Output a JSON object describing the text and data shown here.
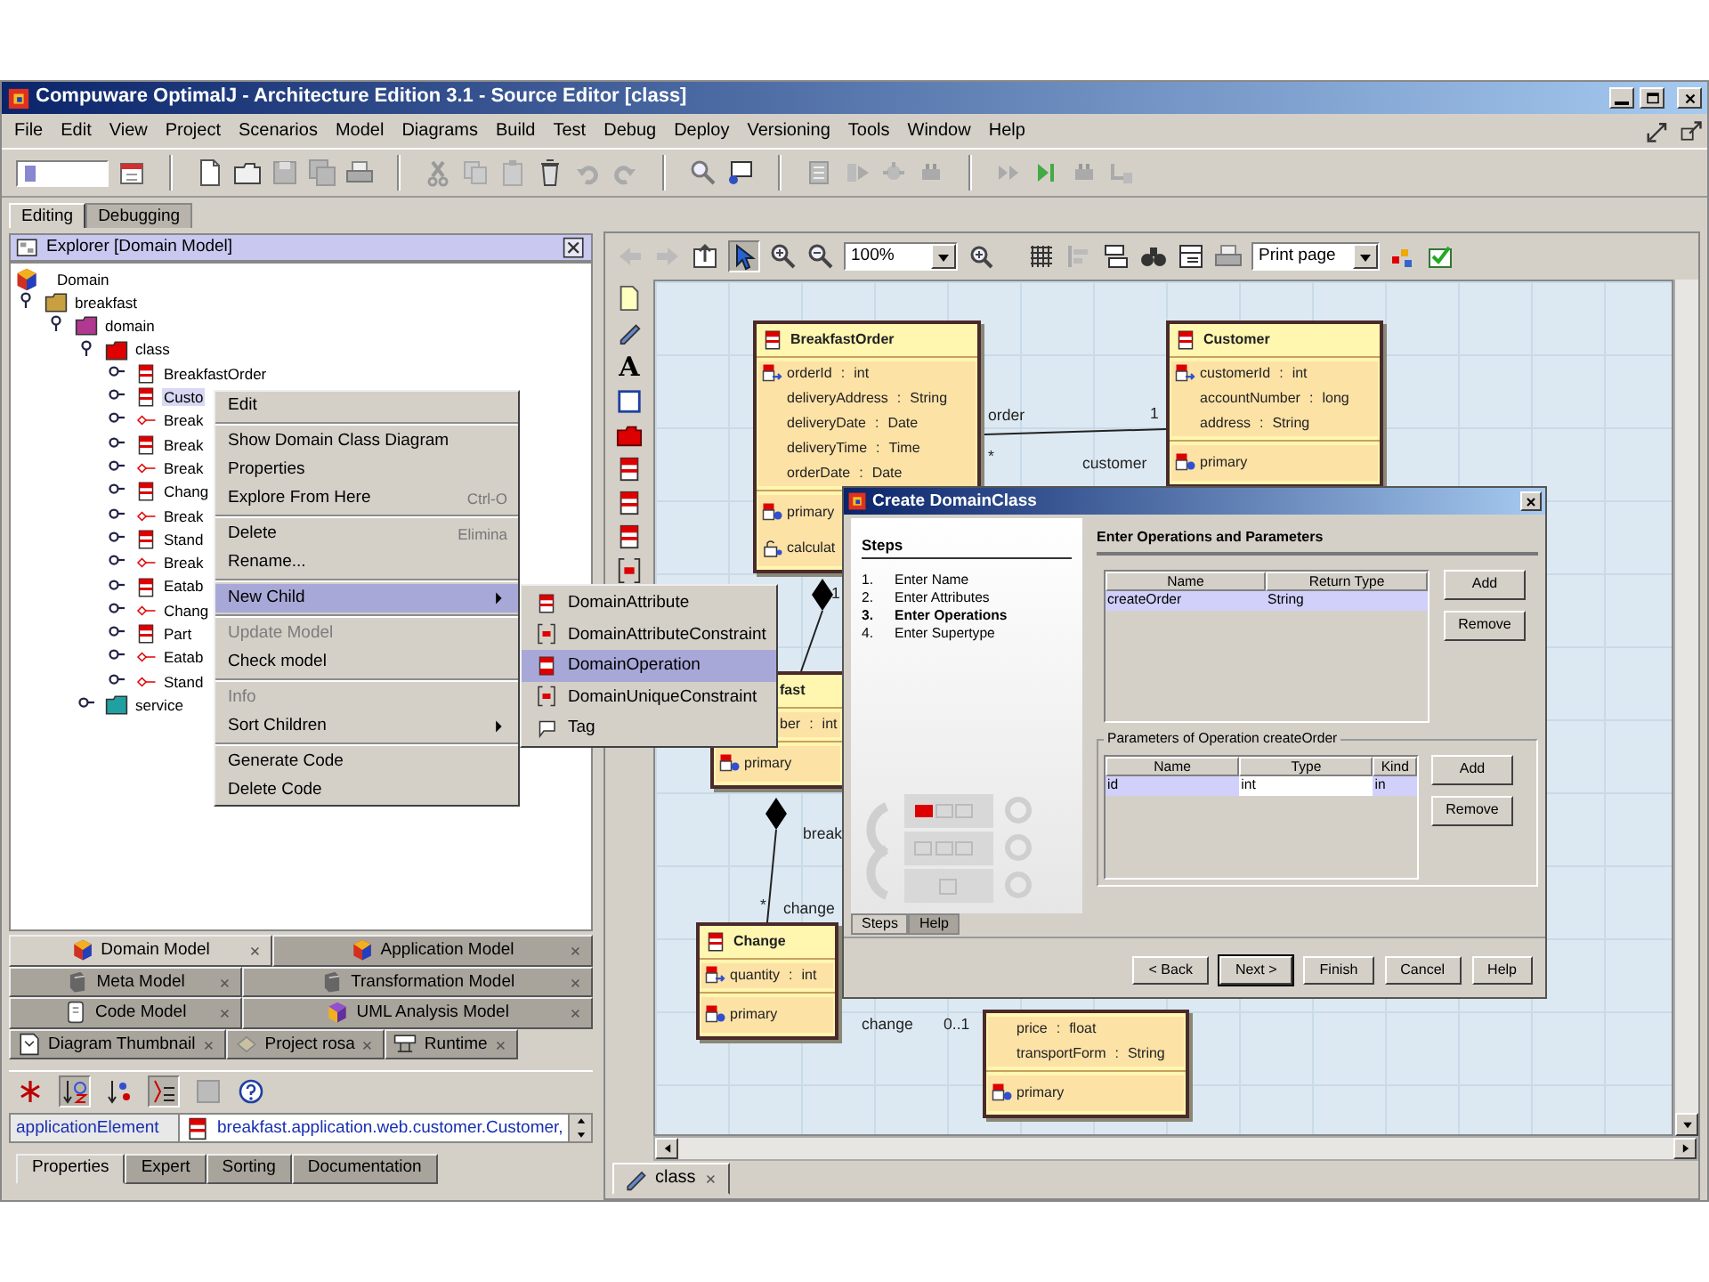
{
  "window": {
    "title": "Compuware OptimalJ - Architecture Edition 3.1  - Source Editor [class]"
  },
  "menu_bar": [
    "File",
    "Edit",
    "View",
    "Project",
    "Scenarios",
    "Model",
    "Diagrams",
    "Build",
    "Test",
    "Debug",
    "Deploy",
    "Versioning",
    "Tools",
    "Window",
    "Help"
  ],
  "perspective_tabs": [
    {
      "label": "Editing",
      "selected": true
    },
    {
      "label": "Debugging",
      "selected": false
    }
  ],
  "explorer": {
    "title": "Explorer [Domain Model]",
    "tree": [
      {
        "label": "Domain",
        "kind": "model",
        "selected": false,
        "children": [
          {
            "label": "breakfast",
            "kind": "package",
            "color": "#c8a040",
            "expanded": true,
            "selected": false,
            "children": [
              {
                "label": "domain",
                "kind": "package",
                "color": "#b03890",
                "expanded": true,
                "selected": false,
                "children": [
                  {
                    "label": "class",
                    "kind": "package",
                    "color": "#e00000",
                    "expanded": true,
                    "selected": false,
                    "children": [
                      {
                        "label": "BreakfastOrder",
                        "kind": "class",
                        "expanded": false,
                        "selected": false
                      },
                      {
                        "label": "Custo",
                        "kind": "class",
                        "expanded": false,
                        "selected": true
                      },
                      {
                        "label": "Break",
                        "kind": "association",
                        "expanded": false,
                        "selected": false
                      },
                      {
                        "label": "Break",
                        "kind": "class",
                        "expanded": false,
                        "selected": false
                      },
                      {
                        "label": "Break",
                        "kind": "association",
                        "expanded": false,
                        "selected": false
                      },
                      {
                        "label": "Chang",
                        "kind": "class",
                        "expanded": false,
                        "selected": false
                      },
                      {
                        "label": "Break",
                        "kind": "association",
                        "expanded": false,
                        "selected": false
                      },
                      {
                        "label": "Stand",
                        "kind": "class",
                        "expanded": false,
                        "selected": false
                      },
                      {
                        "label": "Break",
                        "kind": "association",
                        "expanded": false,
                        "selected": false
                      },
                      {
                        "label": "Eatab",
                        "kind": "class",
                        "expanded": false,
                        "selected": false
                      },
                      {
                        "label": "Chang",
                        "kind": "association",
                        "expanded": false,
                        "selected": false
                      },
                      {
                        "label": "Part",
                        "kind": "class",
                        "expanded": false,
                        "selected": false
                      },
                      {
                        "label": "Eatab",
                        "kind": "association",
                        "expanded": false,
                        "selected": false
                      },
                      {
                        "label": "Stand",
                        "kind": "association",
                        "expanded": false,
                        "selected": false
                      }
                    ]
                  },
                  {
                    "label": "service",
                    "kind": "package",
                    "color": "#20a0a0",
                    "expanded": false,
                    "selected": false
                  }
                ]
              }
            ]
          }
        ]
      }
    ]
  },
  "context_menu": {
    "groups": [
      [
        {
          "label": "Edit",
          "disabled": false,
          "highlighted": false,
          "submenu": false
        }
      ],
      [
        {
          "label": "Show Domain Class Diagram",
          "disabled": false,
          "highlighted": false,
          "submenu": false
        },
        {
          "label": "Properties",
          "disabled": false,
          "highlighted": false,
          "submenu": false
        },
        {
          "label": "Explore From Here",
          "shortcut": "Ctrl-O",
          "disabled": false,
          "highlighted": false,
          "submenu": false
        }
      ],
      [
        {
          "label": "Delete",
          "shortcut": "Elimina",
          "disabled": false,
          "highlighted": false,
          "submenu": false
        },
        {
          "label": "Rename...",
          "disabled": false,
          "highlighted": false,
          "submenu": false
        }
      ],
      [
        {
          "label": "New Child",
          "disabled": false,
          "highlighted": true,
          "submenu": true
        }
      ],
      [
        {
          "label": "Update Model",
          "disabled": true,
          "highlighted": false,
          "submenu": false
        },
        {
          "label": "Check model",
          "disabled": false,
          "highlighted": false,
          "submenu": false
        }
      ],
      [
        {
          "label": "Info",
          "disabled": true,
          "highlighted": false,
          "submenu": false
        },
        {
          "label": "Sort Children",
          "disabled": false,
          "highlighted": false,
          "submenu": true
        }
      ],
      [
        {
          "label": "Generate Code",
          "disabled": false,
          "highlighted": false,
          "submenu": false
        },
        {
          "label": "Delete Code",
          "disabled": false,
          "highlighted": false,
          "submenu": false
        }
      ]
    ]
  },
  "submenu": [
    {
      "label": "DomainAttribute",
      "highlighted": false
    },
    {
      "label": "DomainAttributeConstraint",
      "highlighted": false
    },
    {
      "label": "DomainOperation",
      "highlighted": true
    },
    {
      "label": "DomainUniqueConstraint",
      "highlighted": false
    },
    {
      "label": "Tag",
      "highlighted": false
    }
  ],
  "model_tabs": [
    {
      "tabs": [
        {
          "label": "Domain Model",
          "selected": true
        },
        {
          "label": "Application Model",
          "selected": false
        }
      ]
    },
    {
      "tabs": [
        {
          "label": "Meta Model",
          "selected": false
        },
        {
          "label": "Transformation Model",
          "selected": false
        }
      ]
    },
    {
      "tabs": [
        {
          "label": "Code Model",
          "selected": false
        },
        {
          "label": "UML Analysis Model",
          "selected": false
        }
      ]
    },
    {
      "tabs": [
        {
          "label": "Diagram Thumbnail",
          "selected": false
        },
        {
          "label": "Project rosa",
          "selected": false
        },
        {
          "label": "Runtime",
          "selected": false
        }
      ]
    }
  ],
  "properties": {
    "rows": [
      {
        "name": "applicationElement",
        "value": "breakfast.application.web.customer.Customer,"
      }
    ],
    "tabs": [
      {
        "label": "Properties",
        "selected": true
      },
      {
        "label": "Expert",
        "selected": false
      },
      {
        "label": "Sorting",
        "selected": false
      },
      {
        "label": "Documentation",
        "selected": false
      }
    ]
  },
  "editor": {
    "zoom": "100%",
    "page_mode": "Print page",
    "text_tool": "A",
    "nodes": [
      {
        "name": "BreakfastOrder",
        "attributes": [
          {
            "name": "orderId",
            "separator": ":",
            "type": "int",
            "key": true
          },
          {
            "name": "deliveryAddress",
            "separator": ":",
            "type": "String",
            "key": false
          },
          {
            "name": "deliveryDate",
            "separator": ":",
            "type": "Date",
            "key": false
          },
          {
            "name": "deliveryTime",
            "separator": ":",
            "type": "Time",
            "key": false
          },
          {
            "name": "orderDate",
            "separator": ":",
            "type": "Date",
            "key": false
          }
        ],
        "operations": [
          {
            "name": "primary",
            "kind": "key"
          },
          {
            "name": "calculat",
            "kind": "method"
          }
        ]
      },
      {
        "name": "Customer",
        "attributes": [
          {
            "name": "customerId",
            "separator": ":",
            "type": "int",
            "key": true
          },
          {
            "name": "accountNumber",
            "separator": ":",
            "type": "long",
            "key": false
          },
          {
            "name": "address",
            "separator": ":",
            "type": "String",
            "key": false
          }
        ],
        "operations": [
          {
            "name": "primary",
            "kind": "key"
          }
        ]
      },
      {
        "name": "fast",
        "attributes": [
          {
            "name": "ber",
            "separator": ":",
            "type": "int",
            "key": false
          }
        ],
        "operations": [
          {
            "name": "primary",
            "kind": "key"
          }
        ]
      },
      {
        "name": "Change",
        "attributes": [
          {
            "name": "quantity",
            "separator": ":",
            "type": "int",
            "key": true
          }
        ],
        "operations": [
          {
            "name": "primary",
            "kind": "key"
          }
        ]
      },
      {
        "attributes": [
          {
            "name": "price",
            "separator": ":",
            "type": "float",
            "key": false
          },
          {
            "name": "transportForm",
            "separator": ":",
            "type": "String",
            "key": false
          }
        ],
        "operations": [
          {
            "name": "primary",
            "kind": "key"
          }
        ]
      }
    ],
    "edge_labels": [
      "order",
      "1",
      "*",
      "customer",
      "1",
      "break",
      "*",
      "change",
      "change",
      "0..1"
    ],
    "tabs": [
      {
        "label": "class",
        "selected": true
      }
    ]
  },
  "dialog": {
    "title": "Create DomainClass",
    "steps_title": "Steps",
    "steps": [
      {
        "number": "1.",
        "label": "Enter Name",
        "current": false
      },
      {
        "number": "2.",
        "label": "Enter Attributes",
        "current": false
      },
      {
        "number": "3.",
        "label": "Enter Operations",
        "current": true
      },
      {
        "number": "4.",
        "label": "Enter Supertype",
        "current": false
      }
    ],
    "side_tabs": [
      {
        "label": "Steps",
        "selected": true
      },
      {
        "label": "Help",
        "selected": false
      }
    ],
    "heading": "Enter Operations and Parameters",
    "operations_table": {
      "columns": [
        "Name",
        "Return Type"
      ],
      "rows": [
        {
          "selected": true,
          "cells": [
            {
              "text": "createOrder",
              "editing": false
            },
            {
              "text": "String",
              "editing": false
            }
          ]
        }
      ]
    },
    "operations_buttons": [
      "Add",
      "Remove"
    ],
    "parameters_title": "Parameters of Operation createOrder",
    "parameters_table": {
      "columns": [
        "Name",
        "Type",
        "Kind"
      ],
      "rows": [
        {
          "selected": true,
          "cells": [
            {
              "text": "id",
              "editing": false
            },
            {
              "text": "int",
              "editing": true
            },
            {
              "text": "in",
              "editing": false
            }
          ]
        }
      ]
    },
    "parameters_buttons": [
      "Add",
      "Remove"
    ],
    "footer_buttons": [
      {
        "label": "< Back",
        "focused": false
      },
      {
        "label": "Next >",
        "focused": true
      },
      {
        "label": "Finish",
        "focused": false
      },
      {
        "label": "Cancel",
        "focused": false
      },
      {
        "label": "Help",
        "focused": false
      }
    ]
  }
}
